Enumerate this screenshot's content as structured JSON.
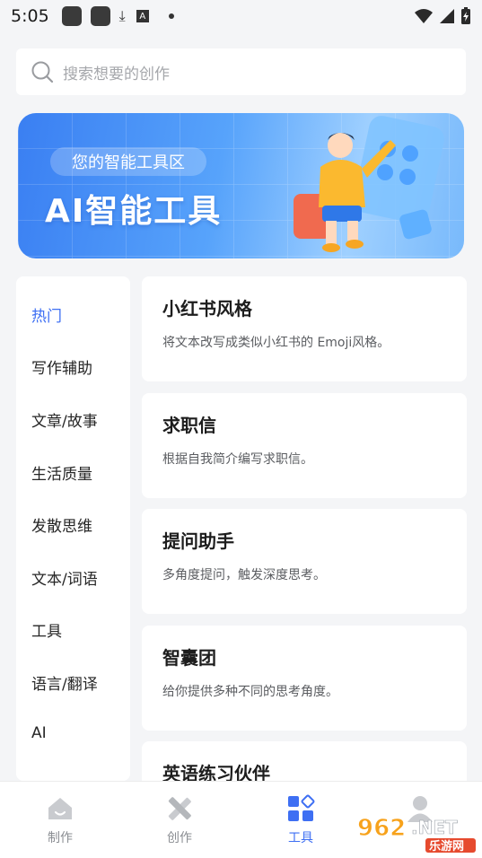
{
  "status_bar": {
    "time": "5:05"
  },
  "search": {
    "placeholder": "搜索想要的创作"
  },
  "banner": {
    "subtitle": "您的智能工具区",
    "title": "AI智能工具"
  },
  "categories": [
    {
      "label": "热门",
      "active": true
    },
    {
      "label": "写作辅助"
    },
    {
      "label": "文章/故事"
    },
    {
      "label": "生活质量"
    },
    {
      "label": "发散思维"
    },
    {
      "label": "文本/词语"
    },
    {
      "label": "工具"
    },
    {
      "label": "语言/翻译"
    },
    {
      "label": "AI"
    }
  ],
  "tools": [
    {
      "title": "小红书风格",
      "desc": "将文本改写成类似小红书的 Emoji风格。"
    },
    {
      "title": "求职信",
      "desc": "根据自我简介编写求职信。"
    },
    {
      "title": "提问助手",
      "desc": "多角度提问，触发深度思考。"
    },
    {
      "title": "智囊团",
      "desc": "给你提供多种不同的思考角度。"
    },
    {
      "title": "英语练习伙伴",
      "desc": ""
    }
  ],
  "bottom_nav": [
    {
      "label": "制作",
      "icon": "house-icon"
    },
    {
      "label": "创作",
      "icon": "pen-ruler-icon"
    },
    {
      "label": "工具",
      "icon": "grid-tools-icon",
      "active": true
    },
    {
      "label": "",
      "icon": "user-icon"
    }
  ],
  "watermark": {
    "number": "962",
    "domain": ".NET",
    "brand": "乐游网"
  },
  "colors": {
    "accent": "#3e6ff3",
    "background": "#f4f5f7"
  }
}
